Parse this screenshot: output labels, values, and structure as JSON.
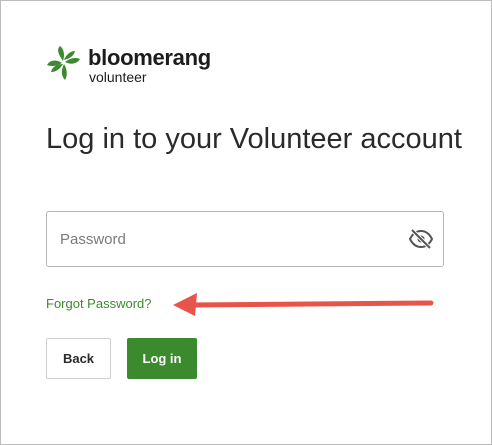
{
  "brand": {
    "name": "bloomerang",
    "product": "volunteer",
    "logo_icon": "bloomerang-logo-icon",
    "color": "#3c8a2e"
  },
  "login": {
    "title": "Log in to your Volunteer account",
    "password_placeholder": "Password",
    "password_value": "",
    "visibility_icon": "eye-slash-icon",
    "forgot_link": "Forgot Password?",
    "back_label": "Back",
    "login_label": "Log in"
  },
  "annotation": {
    "arrow_color": "#e8534a",
    "arrow_icon": "left-arrow-icon"
  }
}
